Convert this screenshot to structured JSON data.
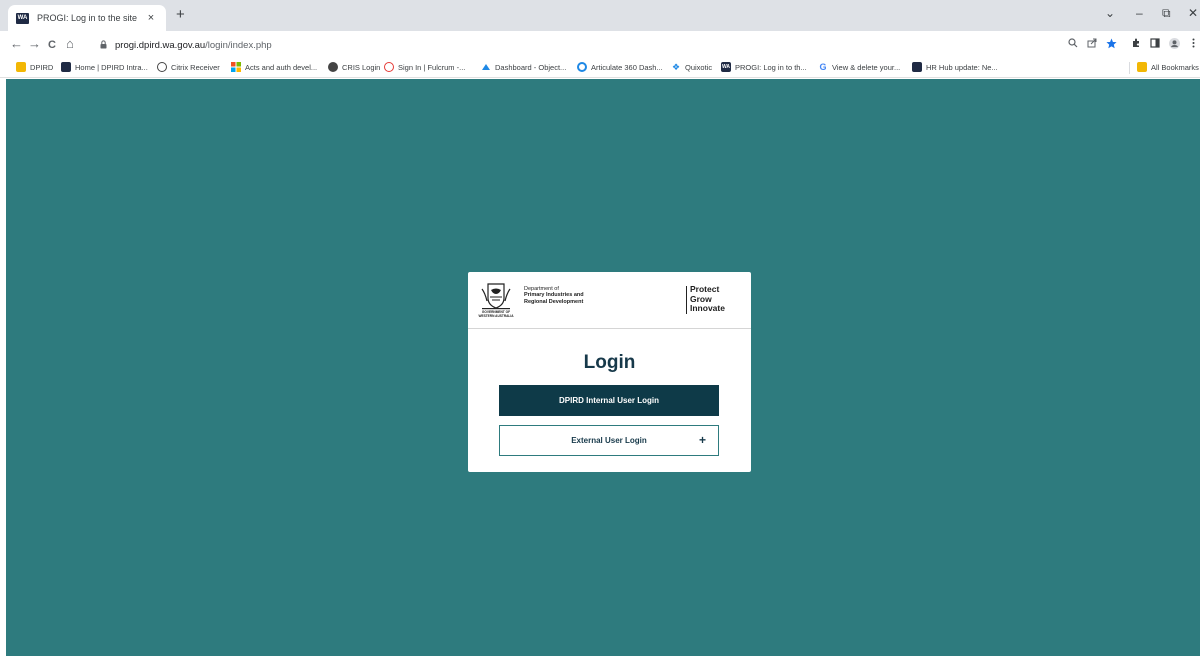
{
  "browser": {
    "tab": {
      "favicon": "WA",
      "title": "PROGI: Log in to the site",
      "close": "×"
    },
    "new_tab": "+",
    "window_controls": {
      "tab_search": "⌄",
      "minimize": "–",
      "restore": "⧉",
      "close": "✕"
    },
    "nav": {
      "back": "←",
      "forward": "→",
      "reload": "C",
      "home": "⌂"
    },
    "url": {
      "domain": "progi.dpird.wa.gov.au",
      "path": "/login/index.php"
    },
    "bookmarks": [
      {
        "label": "DPIRD",
        "icon": "folder-icon",
        "color": "#f2b705"
      },
      {
        "label": "Home | DPIRD Intra...",
        "icon": "dpird-icon",
        "color": "#1f2a44"
      },
      {
        "label": "Citrix Receiver",
        "icon": "citrix-icon",
        "color": "#444444"
      },
      {
        "label": "Acts and auth devel...",
        "icon": "microsoft-icon",
        "color": "#f25022"
      },
      {
        "label": "CRIS Login",
        "icon": "globe-icon",
        "color": "#444444"
      },
      {
        "label": "Sign In | Fulcrum -...",
        "icon": "fulcrum-icon",
        "color": "#e53935"
      },
      {
        "label": "Dashboard - Object...",
        "icon": "dashboard-icon",
        "color": "#1e88e5"
      },
      {
        "label": "Articulate 360 Dash...",
        "icon": "articulate-icon",
        "color": "#1e88e5"
      },
      {
        "label": "Quixotic",
        "icon": "quixotic-icon",
        "color": "#1e88e5"
      },
      {
        "label": "PROGI: Log in to th...",
        "icon": "wa-icon",
        "color": "#1f2a44"
      },
      {
        "label": "View & delete your...",
        "icon": "google-icon",
        "color": "#4285f4"
      },
      {
        "label": "HR Hub update: Ne...",
        "icon": "dpird-icon",
        "color": "#1f2a44"
      }
    ],
    "all_bookmarks": "All Bookmarks"
  },
  "card": {
    "dept_line1": "Department of",
    "dept_line2": "Primary Industries and",
    "dept_line3": "Regional Development",
    "gov_line1": "GOVERNMENT OF",
    "gov_line2": "WESTERN AUSTRALIA",
    "tagline": [
      "Protect",
      "Grow",
      "Innovate"
    ],
    "title": "Login",
    "internal_button": "DPIRD Internal User Login",
    "external_button": "External User Login",
    "external_icon": "+"
  },
  "colors": {
    "page_background": "#2e7b7e",
    "primary_button": "#0e3a48",
    "title_text": "#17394a"
  }
}
